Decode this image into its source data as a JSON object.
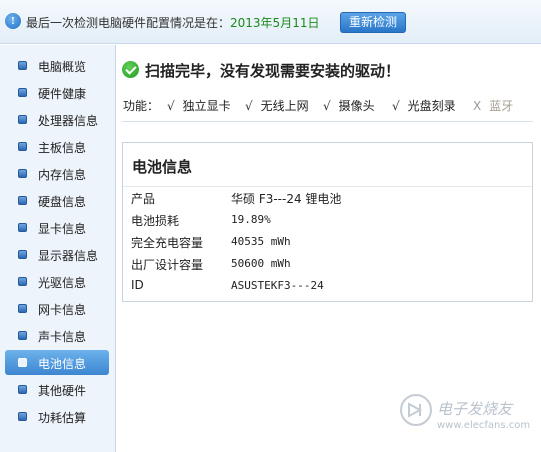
{
  "topbar": {
    "info_icon": "!",
    "prefix": "最后一次检测电脑硬件配置情况是在：",
    "date": "2013年5月11日",
    "recheck_label": "重新检测"
  },
  "sidebar": {
    "items": [
      {
        "label": "电脑概览"
      },
      {
        "label": "硬件健康"
      },
      {
        "label": "处理器信息"
      },
      {
        "label": "主板信息"
      },
      {
        "label": "内存信息"
      },
      {
        "label": "硬盘信息"
      },
      {
        "label": "显卡信息"
      },
      {
        "label": "显示器信息"
      },
      {
        "label": "光驱信息"
      },
      {
        "label": "网卡信息"
      },
      {
        "label": "声卡信息"
      },
      {
        "label": "电池信息"
      },
      {
        "label": "其他硬件"
      },
      {
        "label": "功耗估算"
      }
    ],
    "active_index": 11
  },
  "scan": {
    "message": "扫描完毕，没有发现需要安装的驱动！"
  },
  "functions": {
    "label": "功能：",
    "items": [
      {
        "mark": "√",
        "label": "独立显卡"
      },
      {
        "mark": "√",
        "label": "无线上网"
      },
      {
        "mark": "√",
        "label": "摄像头"
      },
      {
        "mark": "√",
        "label": "光盘刻录"
      },
      {
        "mark": "X",
        "label": "蓝牙"
      }
    ]
  },
  "battery": {
    "title": "电池信息",
    "rows": [
      {
        "label": "产品",
        "value": "华硕 F3---24 锂电池"
      },
      {
        "label": "电池损耗",
        "value": "19.89%"
      },
      {
        "label": "完全充电容量",
        "value": "40535 mWh"
      },
      {
        "label": "出厂设计容量",
        "value": "50600 mWh"
      },
      {
        "label": "ID",
        "value": "ASUSTEKF3---24"
      }
    ]
  },
  "watermark": {
    "name": "电子发烧友",
    "url": "www.elecfans.com"
  },
  "colors": {
    "accent": "#3c86d1",
    "date_green": "#1a8a1a",
    "check_green": "#229a1e"
  }
}
